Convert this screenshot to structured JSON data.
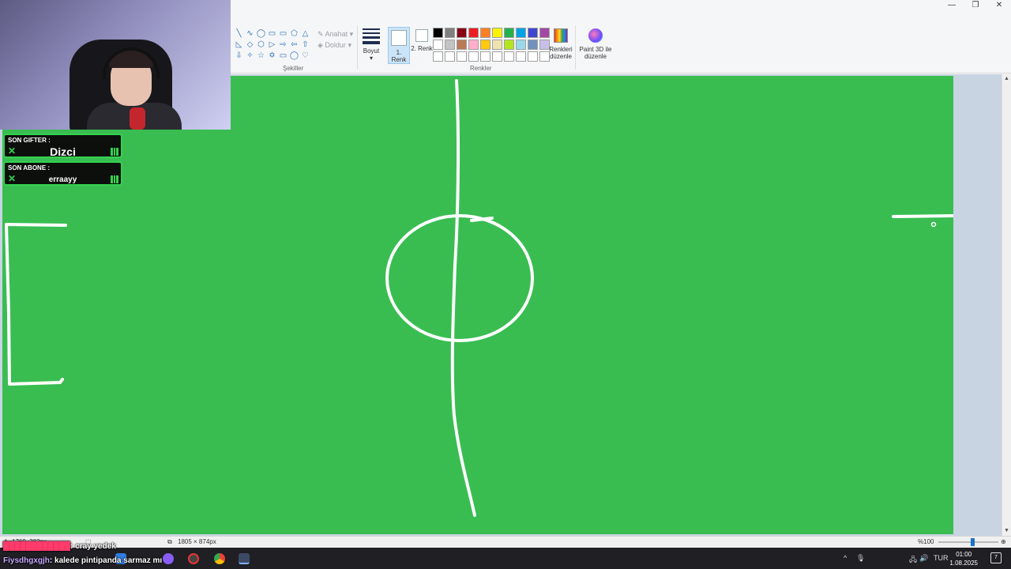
{
  "window": {
    "minimize_glyph": "—",
    "restore_glyph": "❐",
    "close_glyph": "✕"
  },
  "ribbon": {
    "shapes_group_label": "Şekiller",
    "outline_label": "Anahat",
    "fill_label": "Doldur",
    "size_label": "Boyut",
    "color1_label": "1. Renk",
    "color2_label": "2. Renk",
    "colors_group_label": "Renkler",
    "edit_colors_label": "Renkleri düzenle",
    "paint3d_label": "Paint 3D ile düzenle",
    "shape_glyphs": [
      "╲",
      "∿",
      "◯",
      "▭",
      "▭",
      "⬠",
      "△",
      "◺",
      "◇",
      "⬡",
      "▷",
      "⇨",
      "⇦",
      "⇧",
      "⇩",
      "✧",
      "☆",
      "✡",
      "▭",
      "◯",
      "♡"
    ],
    "palette": [
      "#000000",
      "#7f7f7f",
      "#880015",
      "#ed1c24",
      "#ff7f27",
      "#fff200",
      "#22b14c",
      "#00a2e8",
      "#3f48cc",
      "#a349a4",
      "#ffffff",
      "#c3c3c3",
      "#b97a57",
      "#ffaec9",
      "#ffc90e",
      "#efe4b0",
      "#b5e61d",
      "#99d9ea",
      "#7092be",
      "#c8bfe7",
      "#ffffff",
      "#ffffff",
      "#ffffff",
      "#ffffff",
      "#ffffff",
      "#ffffff",
      "#ffffff",
      "#ffffff",
      "#ffffff",
      "#ffffff"
    ]
  },
  "canvas": {
    "background": "#39bd51",
    "stroke_color": "#ffffff"
  },
  "statusbar": {
    "cursor_position": "1769, 282px",
    "canvas_size": "1805 × 874px",
    "zoom": "%100"
  },
  "taskbar": {
    "language": "TUR",
    "time": "01:00",
    "date": "1.08.2025",
    "notification_count": "7"
  },
  "overlay": {
    "last_gifter_title": "SON GIFTER :",
    "last_gifter_name": "Dizci",
    "last_sub_title": "SON ABONE :",
    "last_sub_name": "erraayy",
    "chat": [
      {
        "user": "",
        "message": ": cray yedek"
      },
      {
        "user": "Fiysdhgxgjh",
        "message": ": kalede pintipanda sarmaz mı"
      }
    ]
  }
}
